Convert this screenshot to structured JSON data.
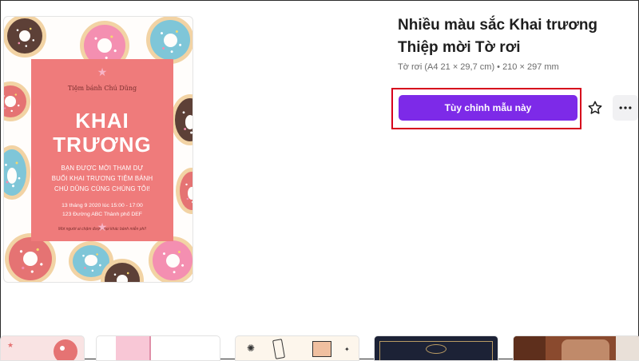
{
  "flyer": {
    "shop_name": "Tiệm bánh Chú Dũng",
    "title_line1": "KHAI",
    "title_line2": "TRƯƠNG",
    "invite_line1": "BẠN ĐƯỢC MỜI THAM DỰ",
    "invite_line2": "BUỔI KHAI TRƯƠNG TIỆM BÁNH",
    "invite_line3": "CHÚ DŨNG CÙNG CHÚNG TÔI!",
    "date_line": "13 tháng 9 2020 lúc 15:00 - 17:00",
    "address_line": "123 Đường ABC Thành phố DEF",
    "footer_note": "Mời người ai chậm được mọi khác bánh miễn phí!"
  },
  "template": {
    "title": "Nhiều màu sắc Khai trương Thiệp mời Tờ rơi",
    "meta": "Tờ rơi (A4 21 × 29,7 cm) • 210 × 297 mm"
  },
  "actions": {
    "customize_label": "Tùy chỉnh mẫu này",
    "favorite_icon": "star-icon",
    "more_icon": "more-horizontal-icon"
  },
  "colors": {
    "accent": "#7d2ae8",
    "highlight_border": "#d6001c",
    "flyer_card": "#ef7b7b"
  }
}
